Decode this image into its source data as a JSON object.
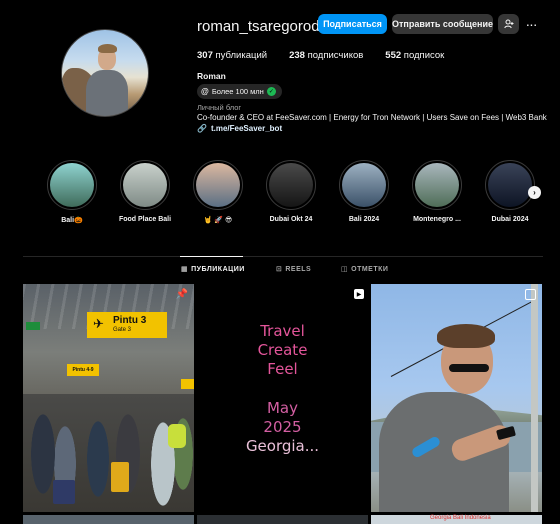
{
  "profile": {
    "username": "roman_tsaregorodtsev",
    "full_name": "Roman",
    "threads_badge": "Более 100 млн",
    "category": "Личный блог",
    "bio": "Co-founder & CEO at FeeSaver.com | Energy for Tron Network | Users Save on Fees | Web3 Bank",
    "link": "t.me/FeeSaver_bot"
  },
  "actions": {
    "follow": "Подписаться",
    "message": "Отправить сообщение",
    "similar_icon": "add-person-icon",
    "more": "···"
  },
  "stats": [
    {
      "value": "307",
      "label": "публикаций"
    },
    {
      "value": "238",
      "label": "подписчиков"
    },
    {
      "value": "552",
      "label": "подписок"
    }
  ],
  "highlights": [
    {
      "label": "Bali🎃",
      "colors": [
        "#3f6b5a",
        "#8fd3d0"
      ]
    },
    {
      "label": "Food Place Bali",
      "colors": [
        "#7f8b86",
        "#c9d1cc"
      ]
    },
    {
      "label": "🤘 🚀 😎",
      "colors": [
        "#5a6f84",
        "#dcb8a0"
      ]
    },
    {
      "label": "Dubai Okt 24",
      "colors": [
        "#151515",
        "#4a4a4a"
      ]
    },
    {
      "label": "Bali 2024",
      "colors": [
        "#3b5168",
        "#9db1c2"
      ]
    },
    {
      "label": "Montenegro ...",
      "colors": [
        "#4f6d57",
        "#a9b7bd"
      ]
    },
    {
      "label": "Dubai 2024",
      "colors": [
        "#0d1424",
        "#3a4358"
      ]
    }
  ],
  "tabs": [
    {
      "label": "ПУБЛИКАЦИИ",
      "icon": "grid-icon",
      "active": true
    },
    {
      "label": "REELS",
      "icon": "reels-icon",
      "active": false
    },
    {
      "label": "ОТМЕТКИ",
      "icon": "tagged-icon",
      "active": false
    }
  ],
  "posts": {
    "airport": {
      "sign_main": "Pintu 3",
      "sign_sub": "Gate 3",
      "sign_small": "Pintu 4-9"
    },
    "quote": {
      "lines": [
        "Travel",
        "Create",
        "Feel",
        "May",
        "2025",
        "Georgia..."
      ]
    },
    "row2_caption": "Georgia  Bali  Indonesia"
  }
}
